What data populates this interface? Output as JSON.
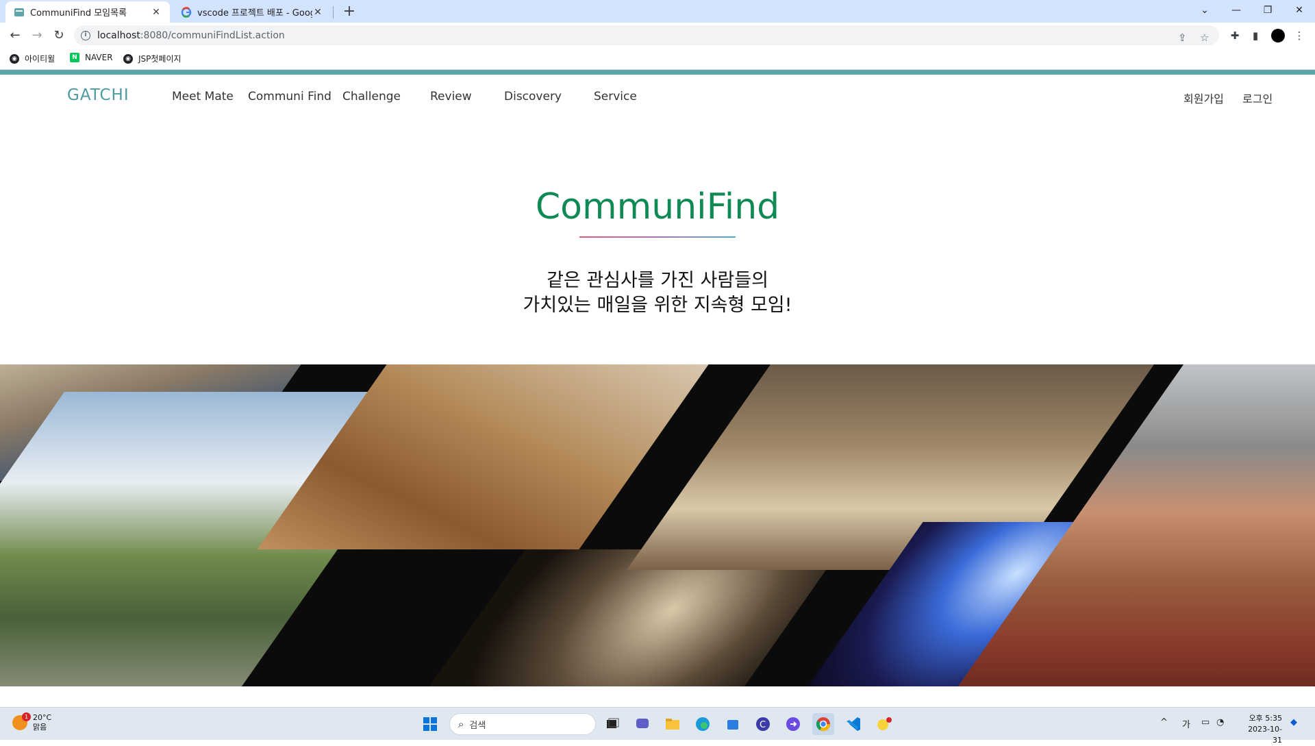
{
  "browser": {
    "tabs": [
      {
        "title": "CommuniFind 모임목록",
        "active": true
      },
      {
        "title": "vscode 프로젝트 배포 - Google",
        "active": false
      }
    ],
    "url_host": "localhost",
    "url_rest": ":8080/communiFindList.action",
    "bookmarks": [
      "아이티윌",
      "NAVER",
      "JSP첫페이지"
    ]
  },
  "site": {
    "logo": "GATCHI",
    "menu": [
      "Meet Mate",
      "Communi Find",
      "Challenge",
      "Review",
      "Discovery",
      "Service"
    ],
    "auth": {
      "signup": "회원가입",
      "login": "로그인"
    },
    "hero": {
      "title": "CommuniFind",
      "subtitle_line1": "같은 관심사를 가진 사람들의",
      "subtitle_line2": "가치있는 매일을 위한 지속형 모임!"
    },
    "colors": {
      "accent_teal": "#5da5a8",
      "title_green": "#0f8a55"
    }
  },
  "taskbar": {
    "weather_temp": "20°C",
    "weather_desc": "맑음",
    "weather_badge": "1",
    "search_placeholder": "검색",
    "ime": "가",
    "time": "오후 5:35",
    "date": "2023-10-31"
  }
}
